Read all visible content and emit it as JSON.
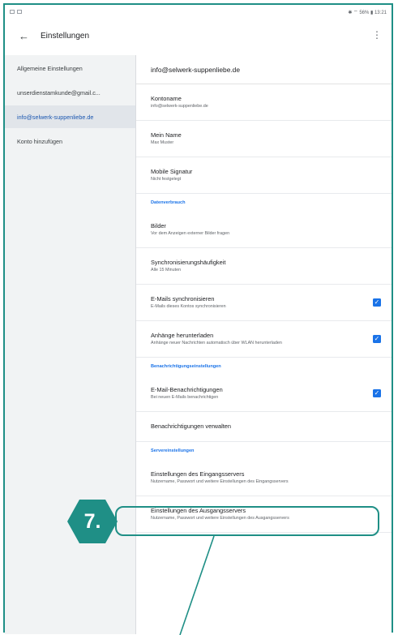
{
  "status_bar": {
    "right_text": "✱ ⌔ 56% ▮ 13:21"
  },
  "topbar": {
    "title": "Einstellungen",
    "back_icon": "arrow-left-icon",
    "more_icon": "more-vert-icon"
  },
  "sidebar": {
    "items": [
      {
        "label": "Allgemeine Einstellungen"
      },
      {
        "label": "unserdienstamkunde@gmail.c..."
      },
      {
        "label": "info@selwerk-suppenliebe.de",
        "active": true
      },
      {
        "label": "Konto hinzufügen"
      }
    ]
  },
  "main": {
    "account_email": "info@selwerk-suppenliebe.de",
    "account_settings": [
      {
        "title": "Kontoname",
        "sub": "info@selwerk-suppenliebe.de"
      },
      {
        "title": "Mein Name",
        "sub": "Max Muster"
      },
      {
        "title": "Mobile Signatur",
        "sub": "Nicht festgelegt"
      }
    ],
    "data_section": "Datenverbrauch",
    "data_settings": [
      {
        "title": "Bilder",
        "sub": "Vor dem Anzeigen externer Bilder fragen"
      },
      {
        "title": "Synchronisierungshäufigkeit",
        "sub": "Alle 15 Minuten"
      },
      {
        "title": "E-Mails synchronisieren",
        "sub": "E-Mails dieses Kontos synchronisieren",
        "checked": true
      },
      {
        "title": "Anhänge herunterladen",
        "sub": "Anhänge neuer Nachrichten automatisch über WLAN herunterladen",
        "checked": true
      }
    ],
    "notification_section": "Benachrichtigungseinstellungen",
    "notification_settings": [
      {
        "title": "E-Mail-Benachrichtigungen",
        "sub": "Bei neuen E-Mails benachrichtigen",
        "checked": true
      },
      {
        "title": "Benachrichtigungen verwalten"
      }
    ],
    "server_section": "Servereinstellungen",
    "server_settings": [
      {
        "title": "Einstellungen des Eingangsservers",
        "sub": "Nutzername, Passwort und weitere Einstellungen des Eingangsservers"
      },
      {
        "title": "Einstellungen des Ausgangsservers",
        "sub": "Nutzername, Passwort und weitere Einstellungen des Ausgangsservers"
      }
    ]
  },
  "callout": {
    "number": "7.",
    "color": "#1f8f86"
  },
  "colors": {
    "accent": "#1a73e8",
    "frame": "#1f8f86",
    "sidebar_bg": "#f1f3f4"
  }
}
